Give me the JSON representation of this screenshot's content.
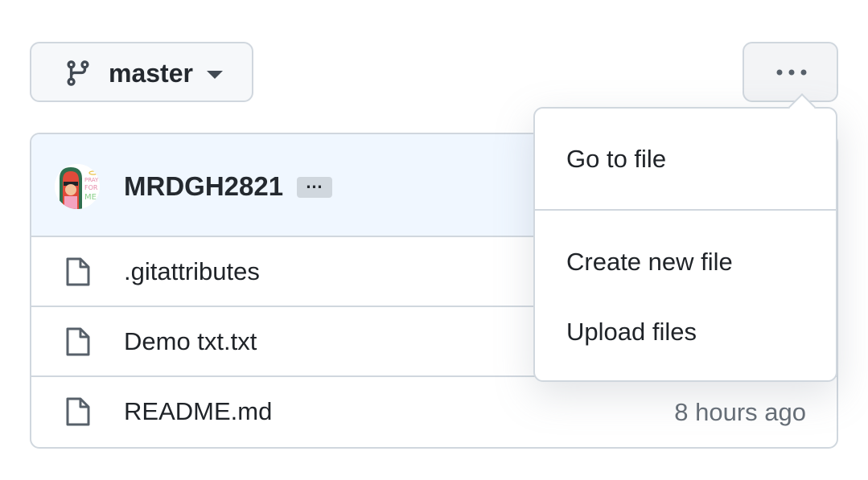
{
  "branch": {
    "name": "master",
    "icon": "git-branch-icon"
  },
  "more_menu": {
    "icon": "kebab-horizontal-icon"
  },
  "commit": {
    "author": "MRDGH2821",
    "ellipsis": "…",
    "avatar": "user-avatar"
  },
  "files": [
    {
      "name": ".gitattributes",
      "time": ""
    },
    {
      "name": "Demo txt.txt",
      "time": ""
    },
    {
      "name": "README.md",
      "time": "8 hours ago"
    }
  ],
  "dropdown": {
    "items": [
      {
        "label": "Go to file"
      },
      {
        "label": "Create new file"
      },
      {
        "label": "Upload files"
      }
    ]
  },
  "colors": {
    "border": "#d0d7de",
    "header_bg": "#f0f7ff",
    "muted_text": "#656d76"
  }
}
